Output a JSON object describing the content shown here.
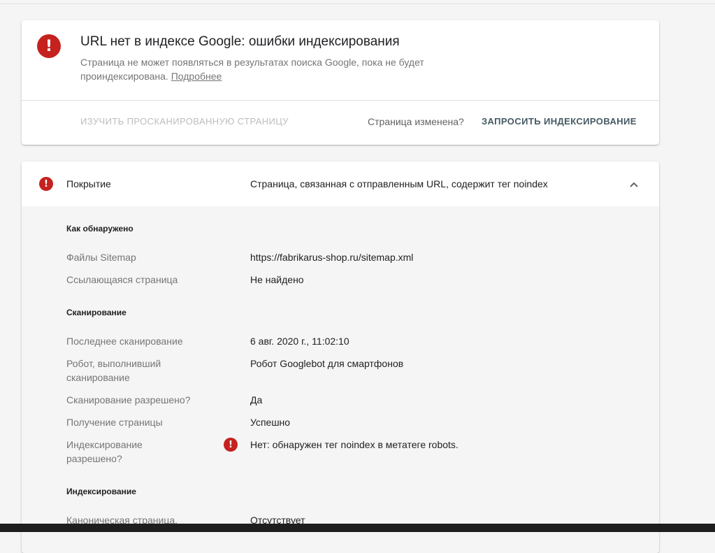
{
  "status_card": {
    "title": "URL нет в индексе Google: ошибки индексирования",
    "description": "Страница не может появляться в результатах поиска Google, пока не будет проиндексирована.",
    "more_link": "Подробнее",
    "inspect_button": "ИЗУЧИТЬ ПРОСКАНИРОВАННУЮ СТРАНИЦУ",
    "changed_question": "Страница изменена?",
    "request_button": "ЗАПРОСИТЬ ИНДЕКСИРОВАНИЕ"
  },
  "coverage": {
    "label": "Покрытие",
    "value": "Страница, связанная с отправленным URL, содержит тег noindex",
    "sections": {
      "discovery": {
        "heading": "Как обнаружено",
        "rows": [
          {
            "label": "Файлы Sitemap",
            "value": "https://fabrikarus-shop.ru/sitemap.xml"
          },
          {
            "label": "Ссылающаяся страница",
            "value": "Не найдено"
          }
        ]
      },
      "crawl": {
        "heading": "Сканирование",
        "rows": [
          {
            "label": "Последнее сканирование",
            "value": "6 авг. 2020 г., 11:02:10"
          },
          {
            "label": "Робот, выполнивший сканирование",
            "value": "Робот Googlebot для смартфонов"
          },
          {
            "label": "Сканирование разрешено?",
            "value": "Да"
          },
          {
            "label": "Получение страницы",
            "value": "Успешно"
          },
          {
            "label": "Индексирование разрешено?",
            "value": "Нет: обнаружен тег noindex в метатеге robots."
          }
        ]
      },
      "indexing": {
        "heading": "Индексирование",
        "rows": [
          {
            "label": "Каноническая страница,",
            "value": "Отсутствует"
          }
        ]
      }
    }
  },
  "colors": {
    "error": "#c5221f",
    "accent_text": "#455a64"
  },
  "icons": {
    "error": "error-icon",
    "collapse": "chevron-up-icon"
  }
}
